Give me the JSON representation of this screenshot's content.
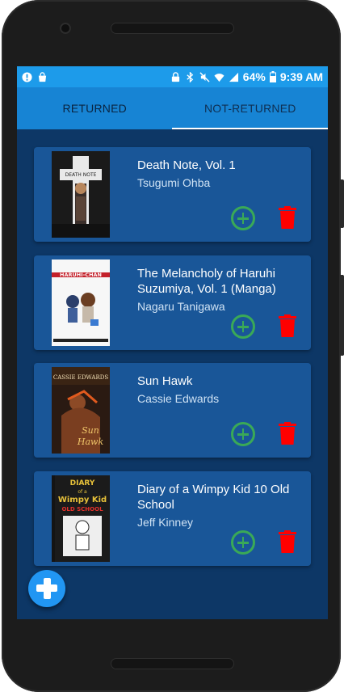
{
  "statusbar": {
    "battery": "64%",
    "time": "9:39 AM",
    "icons": [
      "alert-icon",
      "bag-icon",
      "lock-icon",
      "bluetooth-icon",
      "mute-icon",
      "wifi-icon",
      "signal-icon",
      "battery-icon"
    ]
  },
  "tabs": [
    {
      "label": "RETURNED",
      "active": true
    },
    {
      "label": "NOT-RETURNED",
      "active": false
    }
  ],
  "books": [
    {
      "title": "Death Note, Vol. 1",
      "author": "Tsugumi Ohba",
      "cover_text": "DEATH NOTE"
    },
    {
      "title": "The Melancholy of Haruhi Suzumiya, Vol. 1 (Manga)",
      "author": "Nagaru Tanigawa",
      "cover_text": "HARUHI-CHAN"
    },
    {
      "title": "Sun Hawk",
      "author": "Cassie Edwards",
      "cover_text": "CASSIE EDWARDS"
    },
    {
      "title": "Diary of a Wimpy Kid 10 Old School",
      "author": "Jeff Kinney",
      "cover_text": "DIARY of a Wimpy Kid OLD SCHOOL"
    }
  ],
  "colors": {
    "add": "#3aa957",
    "delete": "#ff0000",
    "appbar": "#1784d4",
    "background": "#0d3766",
    "card": "#195698",
    "fab": "#2196f3"
  }
}
